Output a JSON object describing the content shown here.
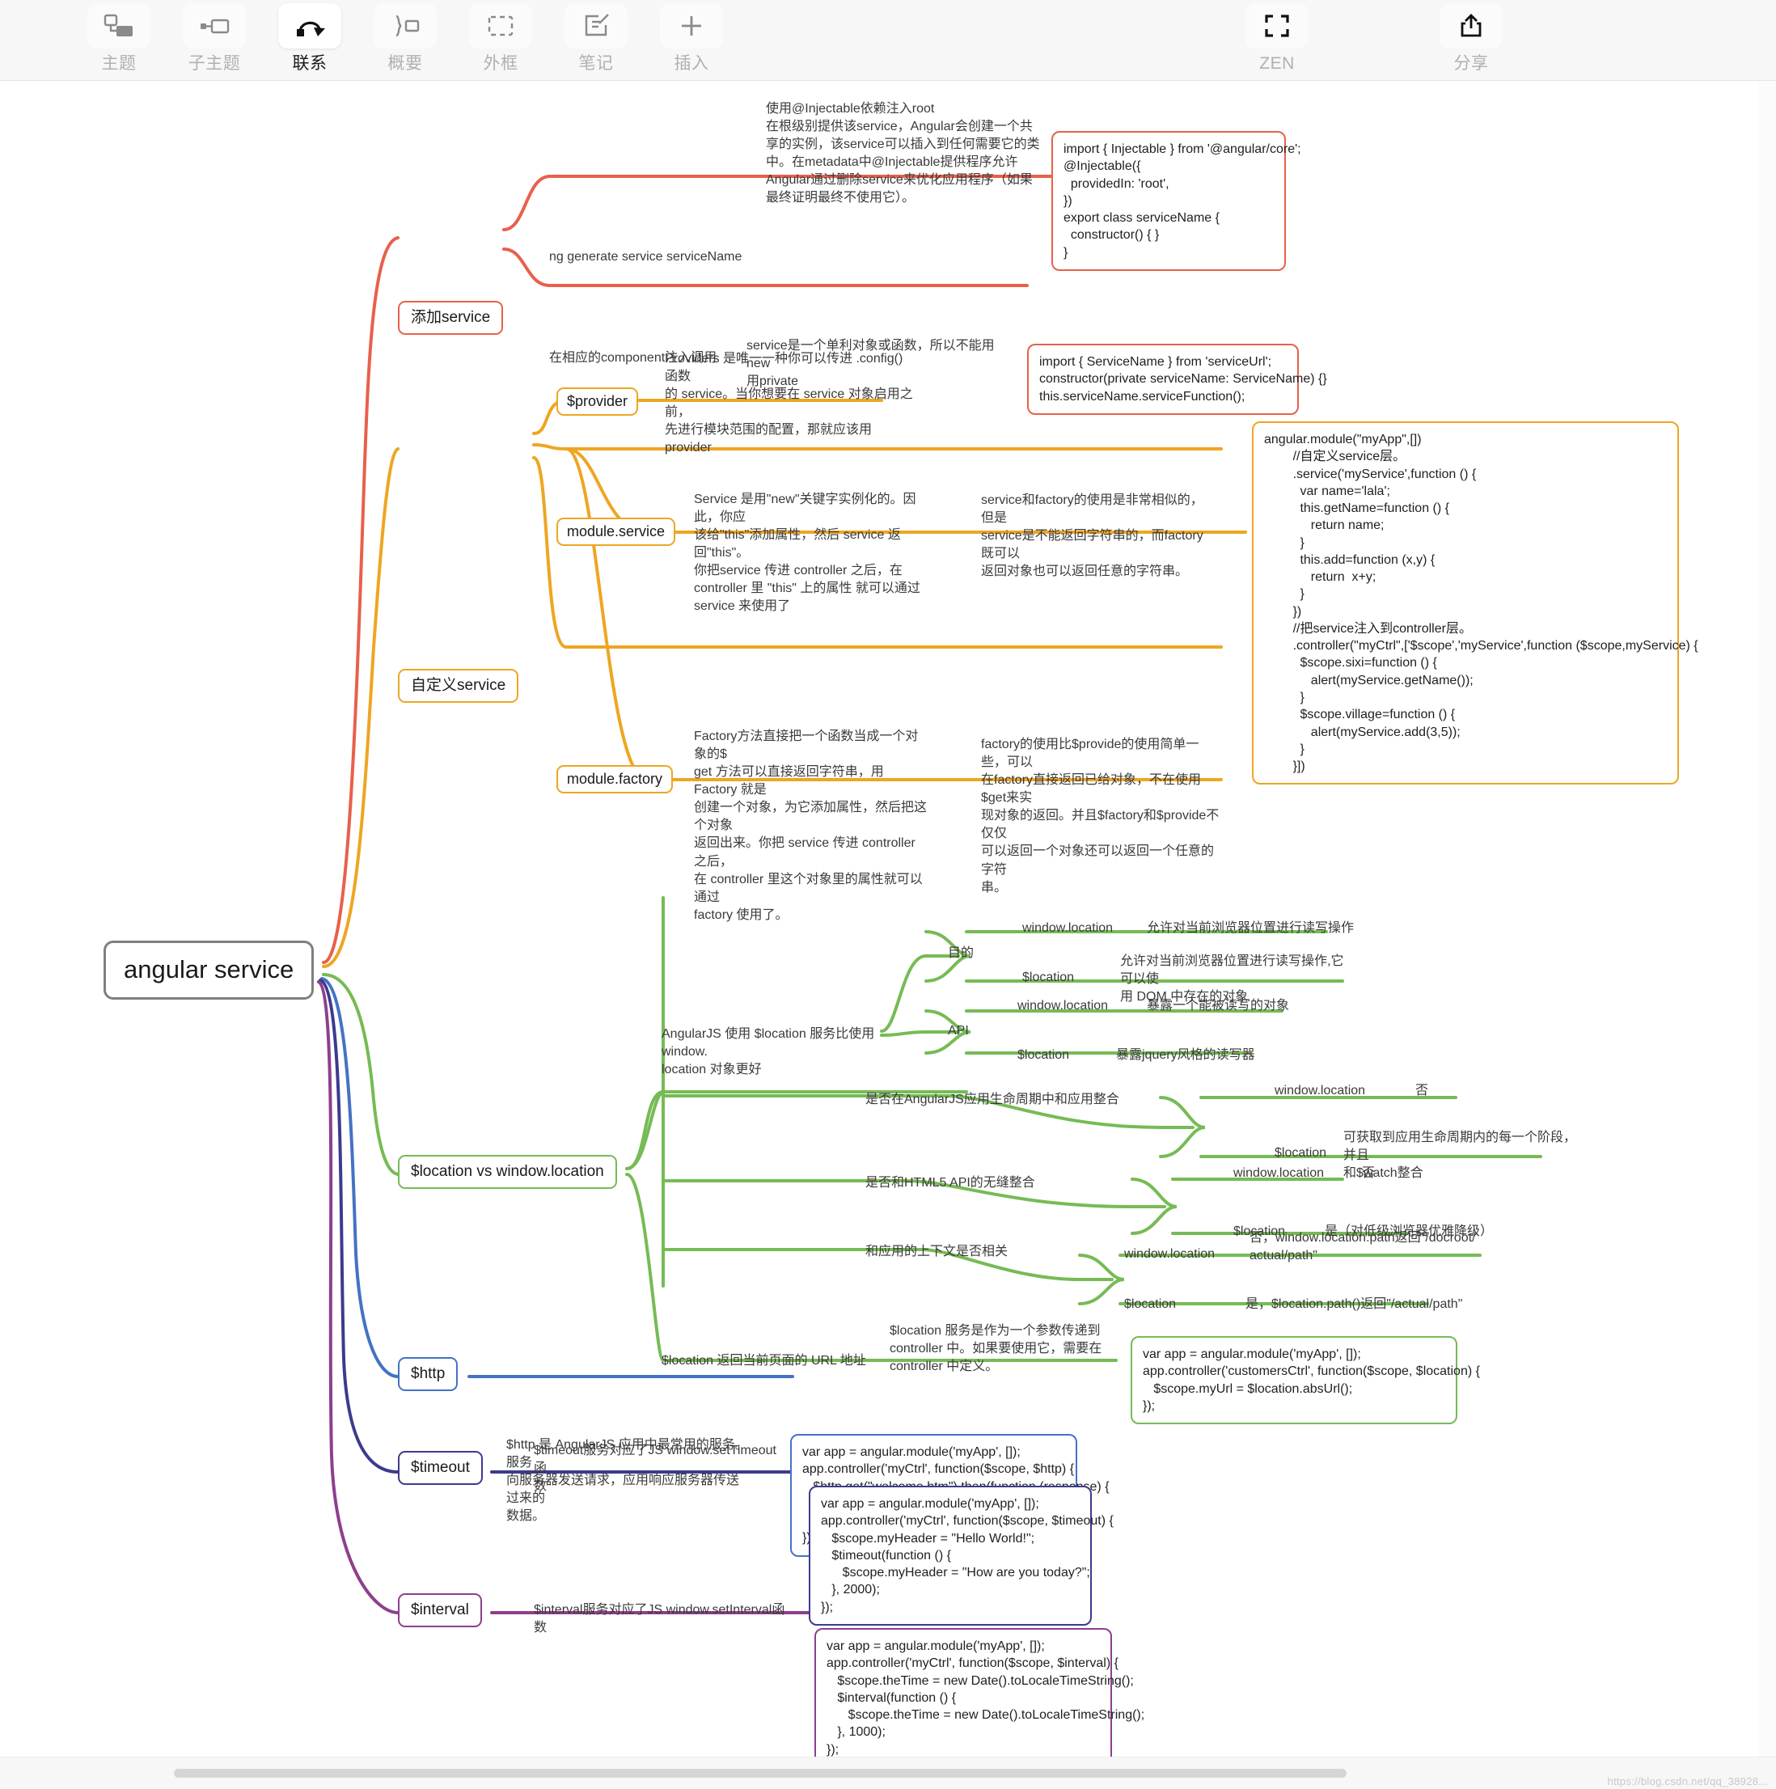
{
  "toolbar": {
    "left_items": [
      {
        "label": "主题",
        "icon": "topic-icon",
        "active": false
      },
      {
        "label": "子主题",
        "icon": "subtopic-icon",
        "active": false
      },
      {
        "label": "联系",
        "icon": "relation-arrow-icon",
        "active": true
      },
      {
        "label": "概要",
        "icon": "summary-icon",
        "active": false
      },
      {
        "label": "外框",
        "icon": "boundary-icon",
        "active": false
      },
      {
        "label": "笔记",
        "icon": "note-icon",
        "active": false
      },
      {
        "label": "插入",
        "icon": "plus-icon",
        "active": false
      }
    ],
    "right_items": [
      {
        "label": "ZEN",
        "icon": "fullscreen-icon",
        "active": false
      },
      {
        "label": "分享",
        "icon": "share-upload-icon",
        "active": false
      }
    ]
  },
  "mindmap": {
    "root": "angular service",
    "colors": {
      "add_service": "#e8604c",
      "custom_service": "#eda623",
      "location": "#76bb55",
      "http": "#4472c4",
      "timeout": "#3c3b8f",
      "interval": "#8d3f8d",
      "root": "#7f7f7f"
    },
    "branches": {
      "add_service": {
        "title": "添加service",
        "child1_label": "ng generate service serviceName",
        "child1_note": "使用@Injectable依赖注入root\n在根级别提供该service，Angular会创建一个共\n享的实例，该service可以插入到任何需要它的类\n中。在metadata中@Injectable提供程序允许\nAngular通过删除service来优化应用程序（如果\n最终证明最终不使用它）。",
        "child1_code": "import { Injectable } from '@angular/core';\n@Injectable({\n  providedIn: 'root',\n})\nexport class serviceName {\n  constructor() { }\n}",
        "child2_label": "在相应的component注入调用",
        "child2_note": "service是一个单利对象或函数，所以不能用new\n用private",
        "child2_code": "import { ServiceName } from 'serviceUrl';\nconstructor(private serviceName: ServiceName) {}\nthis.serviceName.serviceFunction();"
      },
      "custom_service": {
        "title": "自定义service",
        "provider_label": "$provider",
        "provider_note": "Providers 是唯一一种你可以传进 .config() 函数\n的 service。当你想要在 service 对象启用之前，\n先进行模块范围的配置，那就应该用 provider",
        "service_label": "module.service",
        "service_note": "Service 是用\"new\"关键字实例化的。因此，你应\n该给\"this\"添加属性，然后 service 返回\"this\"。\n你把service 传进 controller 之后，在\ncontroller 里 \"this\" 上的属性 就可以通过\nservice 来使用了",
        "service_note2": "service和factory的使用是非常相似的，但是\nservice是不能返回字符串的，而factory既可以\n返回对象也可以返回任意的字符串。",
        "factory_label": "module.factory",
        "factory_note": "Factory方法直接把一个函数当成一个对象的$\nget 方法可以直接返回字符串，用 Factory 就是\n创建一个对象，为它添加属性，然后把这个对象\n返回出来。你把 service 传进 controller 之后，\n在 controller 里这个对象里的属性就可以通过\nfactory 使用了。",
        "factory_note2": "factory的使用比$provide的使用简单一些，可以\n在factory直接返回已给对象，不在使用$get来实\n现对象的返回。并且$factory和$provide不仅仅\n可以返回一个对象还可以返回一个任意的字符\n串。",
        "code": "angular.module(\"myApp\",[])\n        //自定义service层。\n        .service('myService',function () {\n          var name='lala';\n          this.getName=function () {\n             return name;\n          }\n          this.add=function (x,y) {\n             return  x+y;\n          }\n        })\n        //把service注入到controller层。\n        .controller(\"myCtrl\",['$scope','myService',function ($scope,myService) {\n          $scope.sixi=function () {\n             alert(myService.getName());\n          }\n          $scope.village=function () {\n             alert(myService.add(3,5));\n          }\n        }])"
      },
      "location": {
        "title": "$location vs window.location",
        "intro_note": "AngularJS 使用 $location 服务比使用 window.\nlocation 对象更好",
        "rows": [
          {
            "topic": "目的",
            "win_label": "window.location",
            "win_value": "允许对当前浏览器位置进行读写操作",
            "loc_label": "$location",
            "loc_value": "允许对当前浏览器位置进行读写操作,它可以使\n用 DOM 中存在的对象"
          },
          {
            "topic": "API",
            "win_label": "window.location",
            "win_value": "暴露一个能被读写的对象",
            "loc_label": "$location",
            "loc_value": "暴露jquery风格的读写器"
          },
          {
            "topic": "是否在AngularJS应用生命周期中和应用整合",
            "win_label": "window.location",
            "win_value": "否",
            "loc_label": "$location",
            "loc_value": "可获取到应用生命周期内的每一个阶段，并且\n和$watch整合"
          },
          {
            "topic": "是否和HTML5 API的无缝整合",
            "win_label": "window.location",
            "win_value": "否",
            "loc_label": "$location",
            "loc_value": "是（对低级浏览器优雅降级）"
          },
          {
            "topic": "和应用的上下文是否相关",
            "win_label": "window.location",
            "win_value": "否，window.location.path返回\"/docroot/\nactual/path\"",
            "loc_label": "$location",
            "loc_value": "是，$location.path()返回\"/actual/path\""
          }
        ],
        "url_label": "$location 返回当前页面的 URL 地址",
        "url_note": "$location 服务是作为一个参数传递到\ncontroller 中。如果要使用它，需要在\ncontroller 中定义。",
        "url_code": "var app = angular.module('myApp', []);\napp.controller('customersCtrl', function($scope, $location) {\n   $scope.myUrl = $location.absUrl();\n});"
      },
      "http": {
        "title": "$http",
        "note": "$http 是 AngularJS 应用中最常用的服务。服务\n向服务器发送请求，应用响应服务器传送过来的\n数据。",
        "code": "var app = angular.module('myApp', []);\napp.controller('myCtrl', function($scope, $http) {\n   $http.get(\"welcome.htm\").then(function (response) {\n      $scope.myWelcome = response.data;\n   });\n});"
      },
      "timeout": {
        "title": "$timeout",
        "note": "$timeout服务对应了JS window.setTimeout函\n数",
        "code": "var app = angular.module('myApp', []);\napp.controller('myCtrl', function($scope, $timeout) {\n   $scope.myHeader = \"Hello World!\";\n   $timeout(function () {\n      $scope.myHeader = \"How are you today?\";\n   }, 2000);\n});"
      },
      "interval": {
        "title": "$interval",
        "note": "$interval服务对应了JS window.setInterval函数",
        "code": "var app = angular.module('myApp', []);\napp.controller('myCtrl', function($scope, $interval) {\n   $scope.theTime = new Date().toLocaleTimeString();\n   $interval(function () {\n      $scope.theTime = new Date().toLocaleTimeString();\n   }, 1000);\n});"
      }
    }
  },
  "watermark": "https://blog.csdn.net/qq_38928..."
}
